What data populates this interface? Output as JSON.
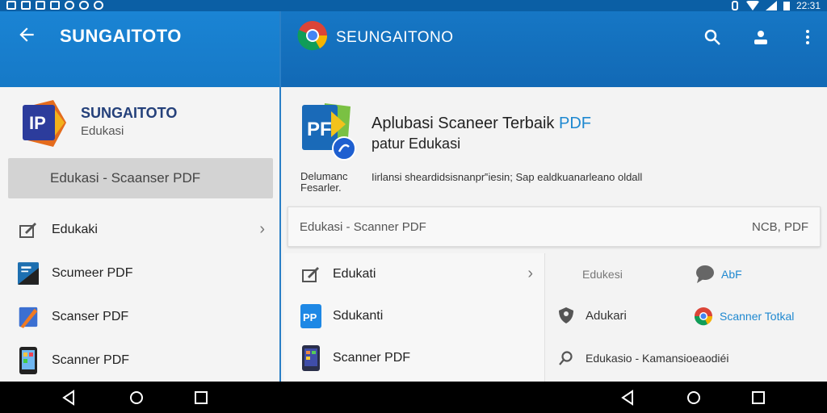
{
  "status": {
    "time": "22:31"
  },
  "left": {
    "title": "SUNGAITOTO",
    "app_name": "SUNGAITOTO",
    "app_sub": "Edukasi",
    "category_button": "Edukasi - Scaanser PDF",
    "items": [
      {
        "label": "Edukaki",
        "icon": "edit-box-icon",
        "chevron": true
      },
      {
        "label": "Scumeer PDF",
        "icon": "scanner-app-icon"
      },
      {
        "label": "Scanser PDF",
        "icon": "pencil-app-icon"
      },
      {
        "label": "Scanner PDF",
        "icon": "phone-app-icon"
      }
    ],
    "logo_text": "IP"
  },
  "right": {
    "title": "SEUNGAITONO",
    "detail_title_a": "Aplubasi Scaneer Terbaik",
    "detail_title_pdf": "PDF",
    "detail_sub": "patur Edukasi",
    "detail_left_1": "Delumanc",
    "detail_left_2": "Fesarler.",
    "detail_desc": "Iirlansi sheardidsisnanpr‟iesin; Sap ealdkuanarleano oldall",
    "logo_text": "PF",
    "info_left": "Edukasi - Scanner PDF",
    "info_right": "NCB, PDF",
    "list": [
      {
        "label": "Edukati",
        "icon": "edit-box-icon",
        "chevron": true
      },
      {
        "label": "Sdukanti",
        "icon": "pdf-app-icon",
        "icon_text": "PP"
      },
      {
        "label": "Scanner PDF",
        "icon": "tablet-app-icon"
      }
    ],
    "grid": {
      "r1_left": "Edukesi",
      "r1_right": "AbF",
      "r2_left": "Adukari",
      "r2_right": "Scanner Totkal",
      "r3": "Edukasio - Kamansioeaodiéi"
    }
  },
  "colors": {
    "accent": "#1a84d4",
    "link": "#1e88d0"
  }
}
